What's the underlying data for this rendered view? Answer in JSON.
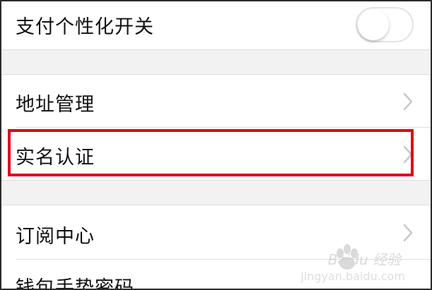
{
  "settings": {
    "payment_personalization": {
      "label": "支付个性化开关",
      "toggle_on": false
    },
    "address": {
      "label": "地址管理"
    },
    "realname": {
      "label": "实名认证"
    },
    "subscription": {
      "label": "订阅中心"
    },
    "wallet_gesture": {
      "label": "钱包手势密码"
    }
  },
  "colors": {
    "highlight": "#e0001b",
    "section_gap": "#f2f2f2",
    "chevron": "#c8c8cc"
  },
  "watermark": {
    "brand": "Baidu",
    "brand_cn": "经验",
    "sub": "jingyan.baidu.com"
  }
}
